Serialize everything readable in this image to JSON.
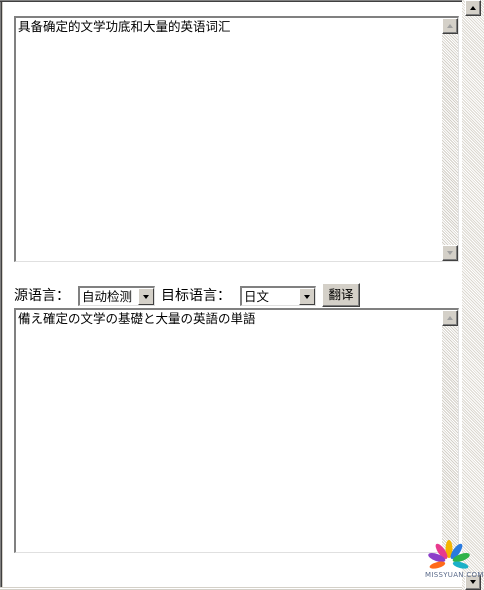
{
  "source_textarea": {
    "value": "具备确定的文学功底和大量的英语词汇"
  },
  "controls": {
    "source_lang_label": "源语言：",
    "source_lang_value": "自动检测",
    "target_lang_label": "目标语言：",
    "target_lang_value": "日文",
    "translate_button": "翻译"
  },
  "result_textarea": {
    "value": "備え確定の文学の基礎と大量の英語の単語"
  },
  "watermark": {
    "text": "MISSYUAN.COM"
  },
  "icons": [
    "scroll-up-arrow-icon",
    "scroll-down-arrow-icon",
    "dropdown-arrow-icon",
    "watermark-logo-icon"
  ]
}
